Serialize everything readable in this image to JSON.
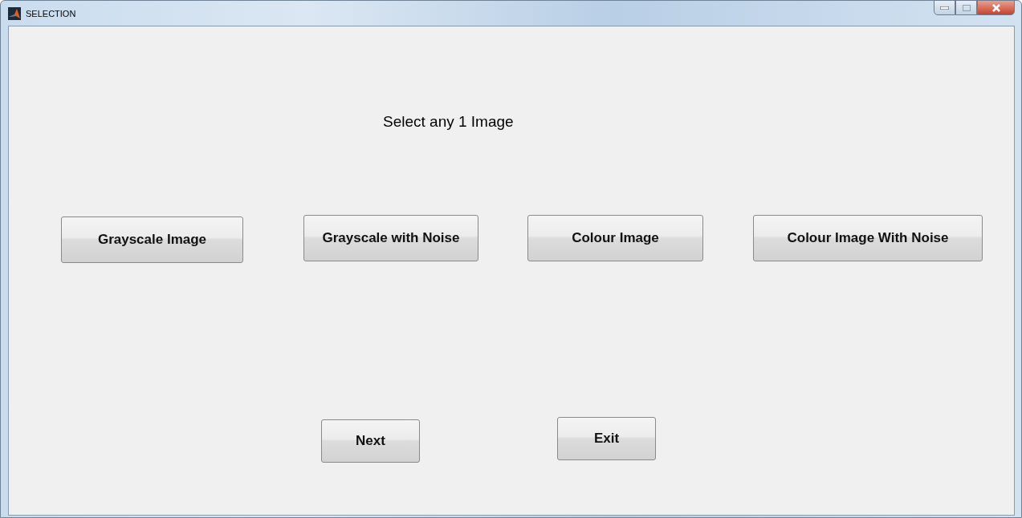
{
  "window": {
    "title": "SELECTION"
  },
  "prompt": "Select any 1 Image",
  "image_buttons": [
    "Grayscale Image",
    "Grayscale with Noise",
    "Colour Image",
    "Colour Image With Noise"
  ],
  "action_buttons": [
    "Next",
    "Exit"
  ]
}
